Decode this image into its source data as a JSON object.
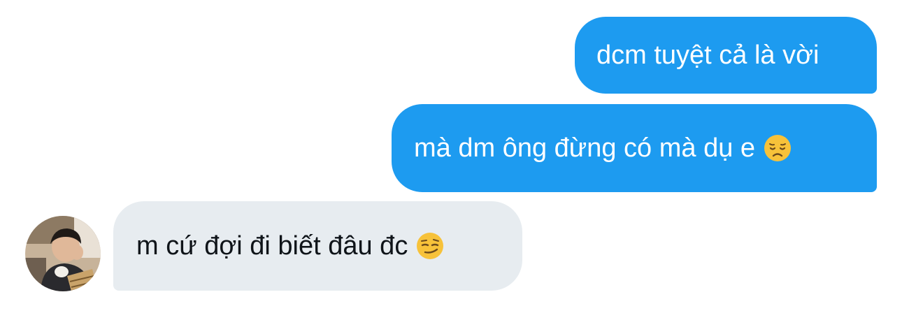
{
  "conversation": {
    "messages": [
      {
        "direction": "sent",
        "text": "dcm tuyệt cả là vời",
        "emoji": null
      },
      {
        "direction": "sent",
        "text": "mà dm ông đừng có mà dụ e",
        "emoji": "disappointed-face-emoji"
      },
      {
        "direction": "received",
        "text": "m cứ đợi đi biết đâu đc",
        "emoji": "smirking-face-emoji"
      }
    ],
    "participant": {
      "avatar": "avatar-photo"
    }
  },
  "colors": {
    "sent_bubble": "#1d9bf0",
    "received_bubble": "#e7ecf0",
    "sent_text": "#ffffff",
    "received_text": "#0f1419",
    "emoji_face": "#f7c23a"
  }
}
